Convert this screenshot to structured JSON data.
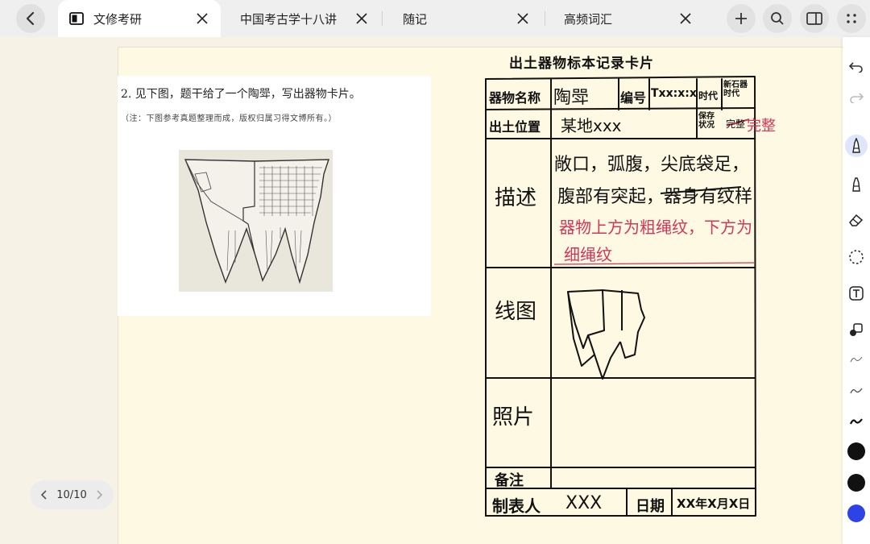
{
  "tabs": [
    {
      "label": "文修考研",
      "active": true
    },
    {
      "label": "中国考古学十八讲",
      "active": false
    },
    {
      "label": "随记",
      "active": false
    },
    {
      "label": "高频词汇",
      "active": false
    }
  ],
  "question": {
    "text": "2.  见下图，题干给了一个陶斝，写出器物卡片。",
    "note": "（注：下图参考真题整理而成，版权归属习得文博所有。）"
  },
  "card": {
    "title": "出土器物标本记录卡片",
    "name_label": "器物名称",
    "name_value": "陶斝",
    "number_label": "编号",
    "number_value": "Txx:x:x",
    "era_label": "时代",
    "era_value": "新石器时代",
    "location_label": "出土位置",
    "location_value": "某地xxx",
    "condition_label": "保存状况",
    "condition_value_struck": "完整",
    "condition_value": "完整",
    "desc_label": "描述",
    "desc_line1": "敞口，弧腹，尖底袋足，",
    "desc_line2_kept": "腹部有突起，",
    "desc_line2_struck": "器身有纹样",
    "desc_red_line1": "器物上方为粗绳纹，下方为",
    "desc_red_line2": "细绳纹",
    "drawing_label": "线图",
    "photo_label": "照片",
    "remark_label": "备注",
    "maker_label": "制表人",
    "maker_value": "XXX",
    "date_label": "日期",
    "date_value": "XX年X月X日"
  },
  "pager": {
    "value": "10/10"
  },
  "colors": {
    "ink": "#111111",
    "red_ink": "#d0375a",
    "pen_blue": "#2d43e6"
  },
  "toolbar_icons": [
    "undo-icon",
    "redo-icon",
    "pen-icon",
    "highlighter-icon",
    "eraser-icon",
    "lasso-icon",
    "text-icon",
    "shape-icon",
    "thin-stroke-icon",
    "medium-stroke-icon",
    "thick-stroke-icon",
    "black-color",
    "black-color",
    "blue-color"
  ]
}
